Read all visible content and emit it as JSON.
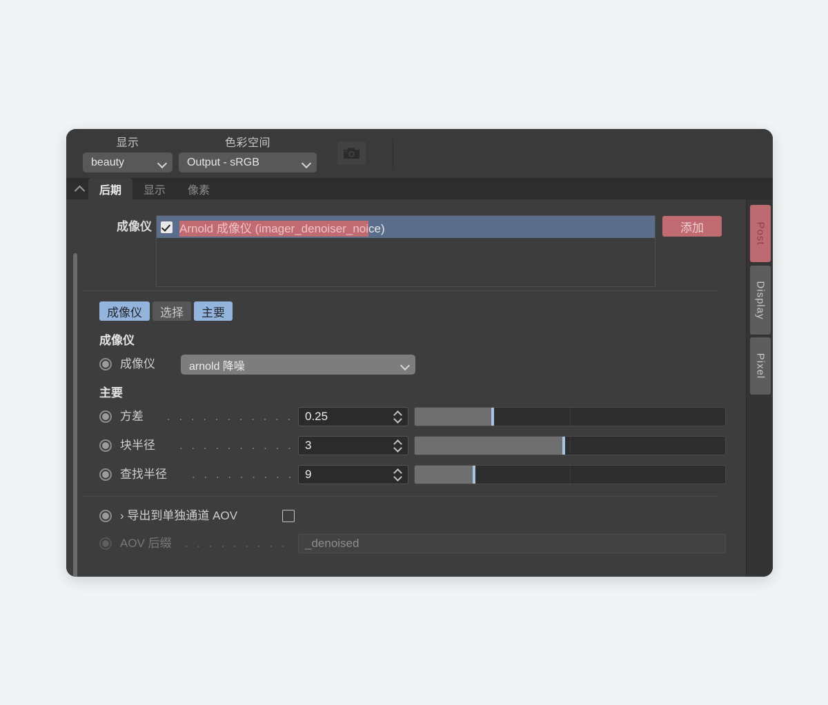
{
  "window": {
    "title": "Arnold Render View - Imager Panel"
  },
  "topbar": {
    "display": {
      "label": "显示",
      "value": "beauty",
      "chevron_icon": "chevron-down-icon"
    },
    "colorspace": {
      "label": "色彩空间",
      "value": "Output - sRGB",
      "chevron_icon": "chevron-down-icon"
    },
    "snapshot": {
      "icon": "camera-icon"
    }
  },
  "tabstrip": {
    "collapse_icon": "chevron-up-icon",
    "tabs": [
      {
        "label": "后期",
        "active": true
      },
      {
        "label": "显示",
        "active": false
      },
      {
        "label": "像素",
        "active": false
      }
    ]
  },
  "imager": {
    "label": "成像仪",
    "item": {
      "checked": true,
      "text_highlighted": "Arnold 成像仪 (imager_denoiser_noi",
      "text_rest": "ce)"
    },
    "add_button": "添加"
  },
  "pills": [
    {
      "label": "成像仪",
      "style": "blue"
    },
    {
      "label": "选择",
      "style": "gray"
    },
    {
      "label": "主要",
      "style": "blue"
    }
  ],
  "section_imager": {
    "header": "成像仪",
    "row": {
      "label": "成像仪",
      "value": "arnold 降噪",
      "chevron_icon": "chevron-down-icon"
    }
  },
  "section_main": {
    "header": "主要",
    "rows": [
      {
        "label": "方差",
        "dots": ". . . . . . . . . . . . .",
        "value": "0.25",
        "fill_percent": 25,
        "tick_percent": 50
      },
      {
        "label": "块半径",
        "dots": ". . . . . . . . . . . .",
        "value": "3",
        "fill_percent": 48,
        "tick_percent": 50
      },
      {
        "label": "查找半径",
        "dots": ". . . . . . . . . . .",
        "value": "9",
        "fill_percent": 19,
        "tick_percent": 50
      }
    ]
  },
  "aov": {
    "export_row": {
      "arrow": "›",
      "label": "导出到单独通道 AOV",
      "checked": false
    },
    "suffix_row": {
      "label": "AOV 后缀",
      "dots": ". . . . . . . . .",
      "value": "_denoised",
      "disabled": true
    }
  },
  "rail": {
    "tabs": [
      {
        "label": "Post",
        "active": true
      },
      {
        "label": "Display",
        "active": false
      },
      {
        "label": "Pixel",
        "active": false
      }
    ]
  },
  "colors": {
    "panel_bg": "#3a3a3a",
    "body_bg": "#3d3d3d",
    "accent_red": "#bd6b71",
    "accent_blue": "#93b4dd",
    "selection_blue": "#5a6e8c"
  }
}
